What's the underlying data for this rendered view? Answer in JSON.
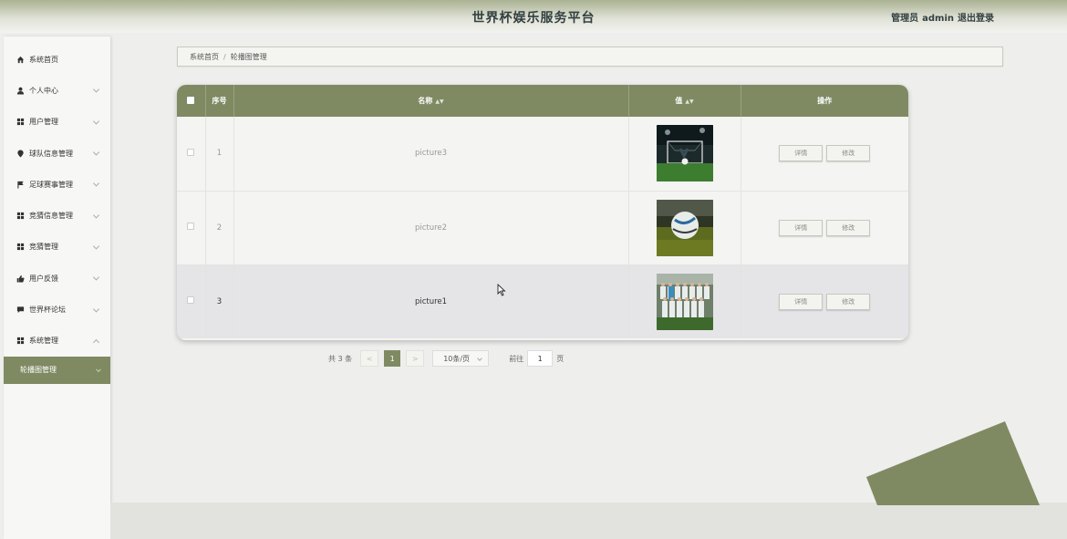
{
  "header": {
    "title": "世界杯娱乐服务平台",
    "role": "管理员",
    "username": "admin",
    "logout_label": "退出登录"
  },
  "sidebar": {
    "items": [
      {
        "label": "系统首页",
        "icon": "home-icon",
        "expandable": false
      },
      {
        "label": "个人中心",
        "icon": "user-icon",
        "expandable": true
      },
      {
        "label": "用户管理",
        "icon": "grid-icon",
        "expandable": true
      },
      {
        "label": "球队信息管理",
        "icon": "location-pin-icon",
        "expandable": true
      },
      {
        "label": "足球赛事管理",
        "icon": "flag-icon",
        "expandable": true
      },
      {
        "label": "竞猜信息管理",
        "icon": "grid-icon",
        "expandable": true
      },
      {
        "label": "竞猜管理",
        "icon": "grid-icon",
        "expandable": true
      },
      {
        "label": "用户反馈",
        "icon": "thumbs-up-icon",
        "expandable": true
      },
      {
        "label": "世界杯论坛",
        "icon": "chat-icon",
        "expandable": true
      },
      {
        "label": "系统管理",
        "icon": "grid-icon",
        "expandable": true,
        "expanded": true
      }
    ],
    "submenu_active": "轮播图管理"
  },
  "breadcrumb": {
    "home": "系统首页",
    "separator": "/",
    "current": "轮播图管理"
  },
  "table": {
    "columns": {
      "index": "序号",
      "name": "名称",
      "value": "值",
      "actions": "操作"
    },
    "rows": [
      {
        "index": "1",
        "name": "picture3",
        "image": "stadium-goal-photo"
      },
      {
        "index": "2",
        "name": "picture2",
        "image": "football-on-pitch-photo"
      },
      {
        "index": "3",
        "name": "picture1",
        "image": "team-photo"
      }
    ],
    "detail_label": "详情",
    "edit_label": "修改"
  },
  "pagination": {
    "total": "共 3 条",
    "prev": "<",
    "current_page": "1",
    "next": ">",
    "page_size": "10条/页",
    "goto_label": "前往",
    "goto_value": "1",
    "page_suffix": "页"
  },
  "colors": {
    "accent": "#7f8a63",
    "background": "#eeeeec"
  }
}
